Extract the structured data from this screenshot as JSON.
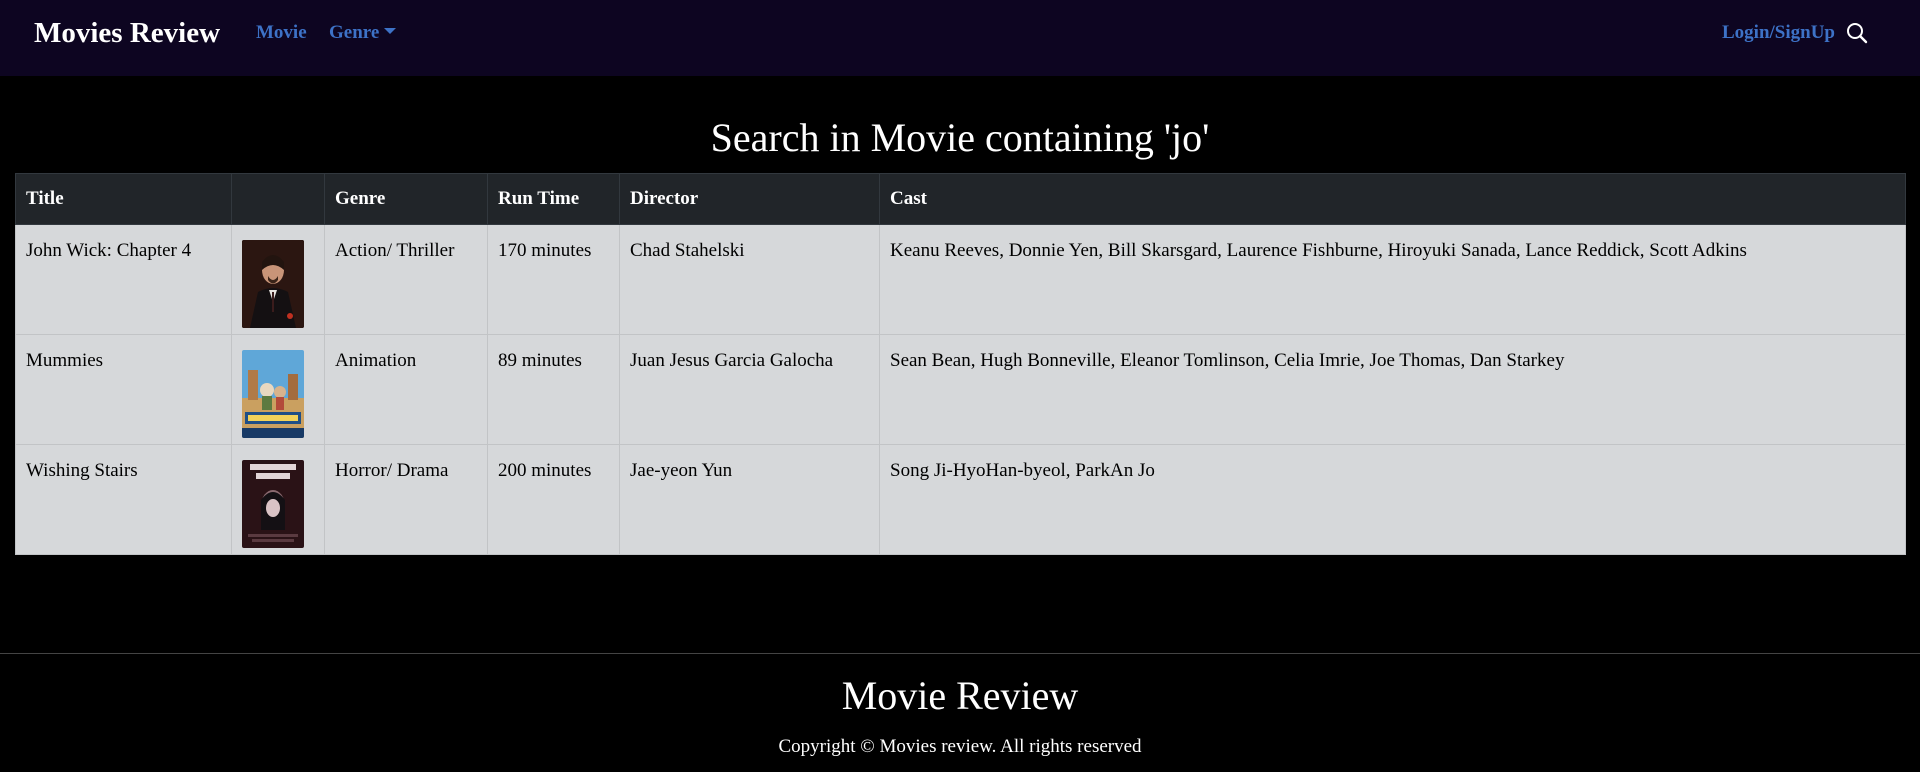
{
  "navbar": {
    "brand": "Movies Review",
    "links": {
      "movie": "Movie",
      "genre": "Genre"
    },
    "login": "Login/SignUp",
    "search_icon": "search-icon",
    "background_color": "#0d0521",
    "link_color": "#3d72c7"
  },
  "page": {
    "title": "Search in Movie containing 'jo'"
  },
  "table": {
    "headers": {
      "title": "Title",
      "poster": "",
      "genre": "Genre",
      "runtime": "Run Time",
      "director": "Director",
      "cast": "Cast"
    },
    "rows": [
      {
        "title": "John Wick: Chapter 4",
        "genre": "Action/ Thriller",
        "runtime": "170 minutes",
        "director": "Chad Stahelski",
        "cast": "Keanu Reeves, Donnie Yen, Bill Skarsgard, Laurence Fishburne, Hiroyuki Sanada, Lance Reddick, Scott Adkins"
      },
      {
        "title": "Mummies",
        "genre": "Animation",
        "runtime": "89 minutes",
        "director": "Juan Jesus Garcia Galocha",
        "cast": "Sean Bean, Hugh Bonneville, Eleanor Tomlinson, Celia Imrie, Joe Thomas, Dan Starkey"
      },
      {
        "title": "Wishing Stairs",
        "genre": "Horror/ Drama",
        "runtime": "200 minutes",
        "director": "Jae-yeon Yun",
        "cast": "Song Ji-HyoHan-byeol, ParkAn Jo"
      }
    ],
    "header_background": "#212529",
    "row_background": "#d6d8da"
  },
  "footer": {
    "title": "Movie Review",
    "copyright": "Copyright © Movies review. All rights reserved"
  }
}
